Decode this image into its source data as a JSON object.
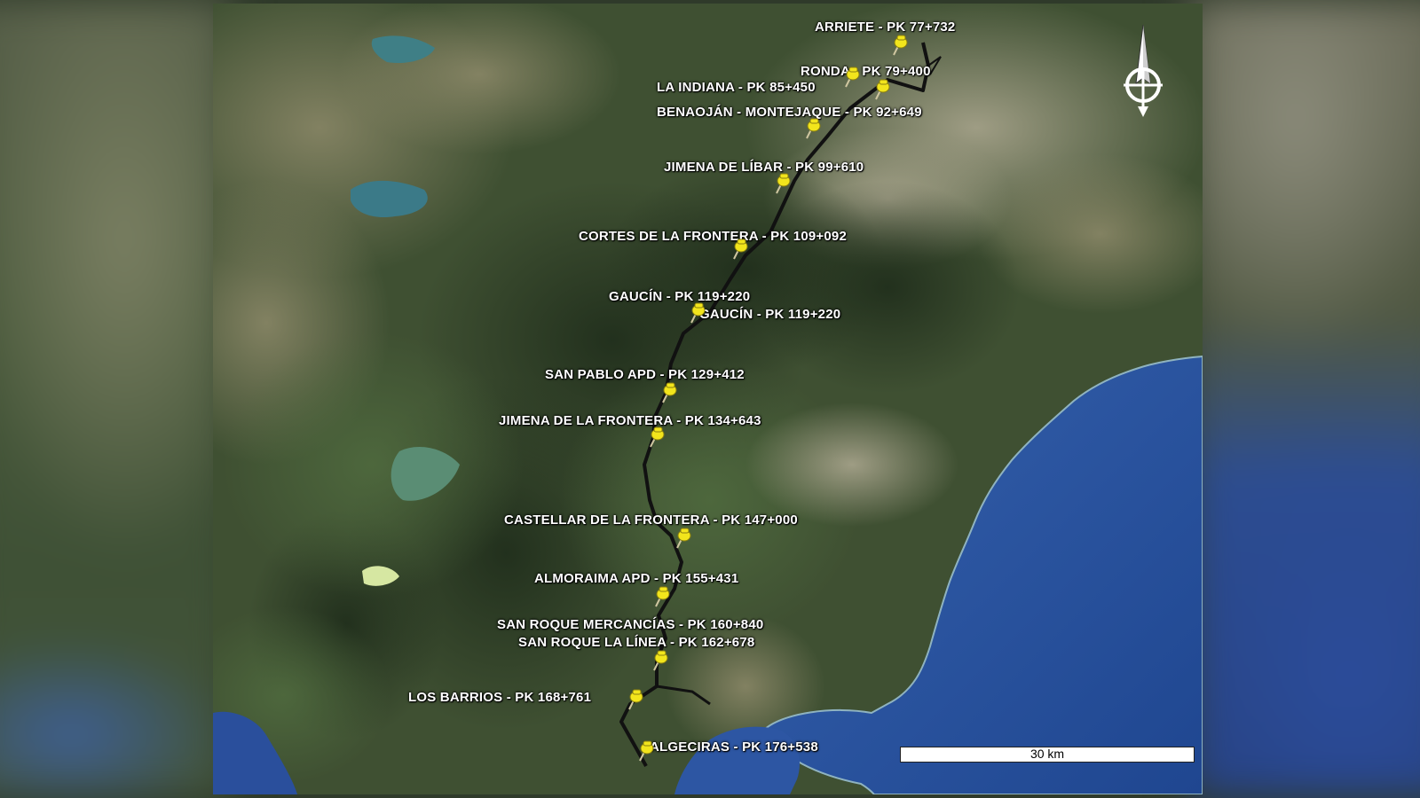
{
  "map": {
    "scale_label": "30 km",
    "north_arrow_icon": "compass-north-arrow-icon",
    "pin_icon": "yellow-pushpin-icon",
    "colors": {
      "sea": "#2a4f9c",
      "route": "#111111",
      "pin": "#f2e51c",
      "label": "#ffffff"
    },
    "labels": [
      {
        "id": "arriete",
        "text": "ARRIETE - PK 77+732"
      },
      {
        "id": "ronda",
        "text": "RONDA - PK 79+400"
      },
      {
        "id": "la-indiana",
        "text": "LA INDIANA - PK 85+450"
      },
      {
        "id": "benaojan",
        "text": "BENAOJÁN - MONTEJAQUE - PK 92+649"
      },
      {
        "id": "jimena-de-libar",
        "text": "JIMENA DE LÍBAR - PK 99+610"
      },
      {
        "id": "cortes",
        "text": "CORTES DE LA FRONTERA - PK 109+092"
      },
      {
        "id": "gaucin-1",
        "text": "GAUCÍN - PK 119+220"
      },
      {
        "id": "gaucin-2",
        "text": "GAUCÍN - PK 119+220"
      },
      {
        "id": "san-pablo",
        "text": "SAN PABLO APD - PK 129+412"
      },
      {
        "id": "jimena-frontera",
        "text": "JIMENA DE LA FRONTERA - PK 134+643"
      },
      {
        "id": "castellar",
        "text": "CASTELLAR DE LA FRONTERA - PK 147+000"
      },
      {
        "id": "almoraima",
        "text": "ALMORAIMA APD - PK 155+431"
      },
      {
        "id": "san-roque-mercancias",
        "text": "SAN ROQUE MERCANCÍAS - PK 160+840"
      },
      {
        "id": "san-roque-la-linea",
        "text": "SAN ROQUE LA LÍNEA - PK 162+678"
      },
      {
        "id": "los-barrios",
        "text": "LOS BARRIOS - PK 168+761"
      },
      {
        "id": "algeciras",
        "text": "ALGECIRAS - PK 176+538"
      }
    ]
  }
}
